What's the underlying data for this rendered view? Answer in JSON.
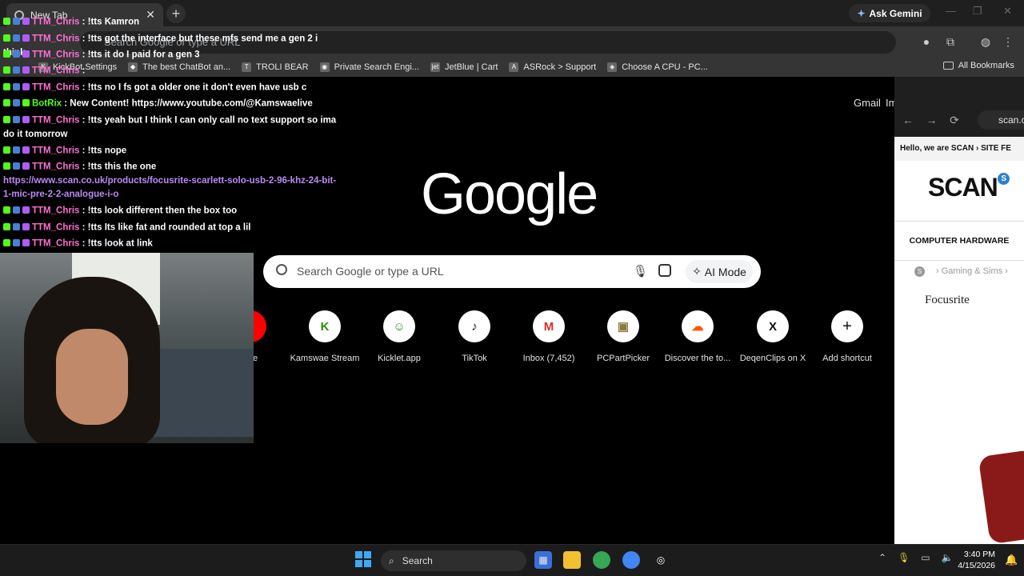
{
  "browser": {
    "tab_title": "New Tab",
    "tab_close": "✕",
    "new_tab": "+",
    "ask_gemini": "Ask Gemini",
    "omnibox_placeholder": "Search Google or type a URL",
    "bookmarks": [
      {
        "label": "KickBot Settings",
        "icon": "K"
      },
      {
        "label": "The best ChatBot an...",
        "icon": "◆"
      },
      {
        "label": "TROLI BEAR",
        "icon": "T"
      },
      {
        "label": "Private Search Engi...",
        "icon": "◉"
      },
      {
        "label": "JetBlue | Cart",
        "icon": "jet"
      },
      {
        "label": "ASRock > Support",
        "icon": "A"
      },
      {
        "label": "Choose A CPU - PC...",
        "icon": "◈"
      }
    ],
    "all_bookmarks": "All Bookmarks"
  },
  "ntp": {
    "gmail": "Gmail",
    "images": "Im",
    "logo": "Google",
    "search_placeholder": "Search Google or type a URL",
    "ai_mode": "AI Mode",
    "shortcuts": [
      {
        "label": "ube",
        "icon": ""
      },
      {
        "label": "Kamswae Stream",
        "icon": "K"
      },
      {
        "label": "Kicklet.app",
        "icon": "☺"
      },
      {
        "label": "TikTok",
        "icon": "♪"
      },
      {
        "label": "Inbox (7,452)",
        "icon": "M"
      },
      {
        "label": "PCPartPicker",
        "icon": "▣"
      },
      {
        "label": "Discover the to...",
        "icon": "☁"
      },
      {
        "label": "DeqenClips on X",
        "icon": "X"
      },
      {
        "label": "Add shortcut",
        "icon": "+"
      }
    ]
  },
  "chat": [
    {
      "user": "TTM_Chris",
      "text": " : !tts Kamron",
      "badge": "k-s-p"
    },
    {
      "user": "TTM_Chris",
      "text": " : !tts got the interface but these mfs send me a gen 2 i think",
      "badge": "k-s-p"
    },
    {
      "user": "TTM_Chris",
      "text": " : !tts it do I paid for a gen 3",
      "badge": "k-s-p"
    },
    {
      "user": "TTM_Chris",
      "text": " :",
      "badge": "k-s-p"
    },
    {
      "user": "TTM_Chris",
      "text": " : !tts no I fs got a older one it don't even have usb c",
      "badge": "k-s-p"
    },
    {
      "user": "BotRix",
      "text": " : New Content! https://www.youtube.com/@Kamswaelive",
      "badge": "k-s-p"
    },
    {
      "user": "TTM_Chris",
      "text": " : !tts yeah but I think I can only call no text support so ima do it tomorrow",
      "badge": "k-s-p"
    },
    {
      "user": "TTM_Chris",
      "text": " : !tts nope",
      "badge": "k-s-p"
    },
    {
      "user": "TTM_Chris",
      "text": " : !tts this the one",
      "badge": "k-s-p"
    },
    {
      "user": "",
      "text": "https://www.scan.co.uk/products/focusrite-scarlett-solo-usb-2-96-khz-24-bit-1-mic-pre-2-2-analogue-i-o",
      "badge": ""
    },
    {
      "user": "TTM_Chris",
      "text": " : !tts look different then the box too",
      "badge": "k-s-p"
    },
    {
      "user": "TTM_Chris",
      "text": " : !tts Its like fat and rounded at top a lil",
      "badge": "k-s-p"
    },
    {
      "user": "TTM_Chris",
      "text": " : !tts look at link",
      "badge": "k-s-p"
    }
  ],
  "side": {
    "url": "scan.c",
    "promo": "Hello, we are SCAN ›  SITE FE",
    "logo": "SCAN",
    "logo_badge": "S",
    "category": "COMPUTER HARDWARE",
    "crumb_badge": "S",
    "crumb": "›  Gaming & Sims  ›",
    "brand": "Focusrite"
  },
  "taskbar": {
    "search": "Search",
    "time": "3:40 PM",
    "date": "4/15/2026"
  }
}
